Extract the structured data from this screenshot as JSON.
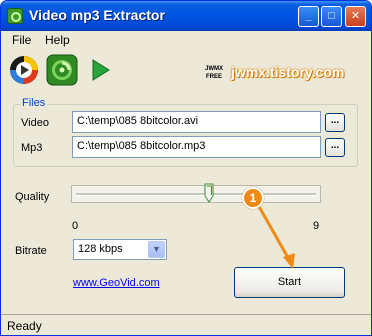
{
  "window": {
    "title": "Video mp3 Extractor"
  },
  "titlebar_buttons": {
    "minimize": "_",
    "maximize": "□",
    "close": "✕"
  },
  "menu": {
    "file": "File",
    "help": "Help"
  },
  "toolbar": {
    "icons": [
      "play-media-icon",
      "extract-audio-icon",
      "start-arrow-icon"
    ]
  },
  "branding": {
    "badge_line1": "JWMX",
    "badge_line2": "FREE",
    "site": "jwmx.tistory.com"
  },
  "files_group": {
    "label": "Files",
    "video_label": "Video",
    "video_value": "C:\\temp\\085 8bitcolor.avi",
    "mp3_label": "Mp3",
    "mp3_value": "C:\\temp\\085 8bitcolor.mp3",
    "browse_label": "..."
  },
  "quality": {
    "label": "Quality",
    "min_label": "0",
    "max_label": "9",
    "min": 0,
    "max": 9,
    "value": 5
  },
  "bitrate": {
    "label": "Bitrate",
    "selected": "128 kbps"
  },
  "link": {
    "text": "www.GeoVid.com"
  },
  "start_button": {
    "label": "Start"
  },
  "annotation": {
    "number": "1",
    "color": "#f08a14"
  },
  "status": {
    "text": "Ready"
  },
  "colors": {
    "titlebar": "#0054e3",
    "link": "#0000ff",
    "group_label": "#0046d5",
    "brand": "#e58a14"
  }
}
